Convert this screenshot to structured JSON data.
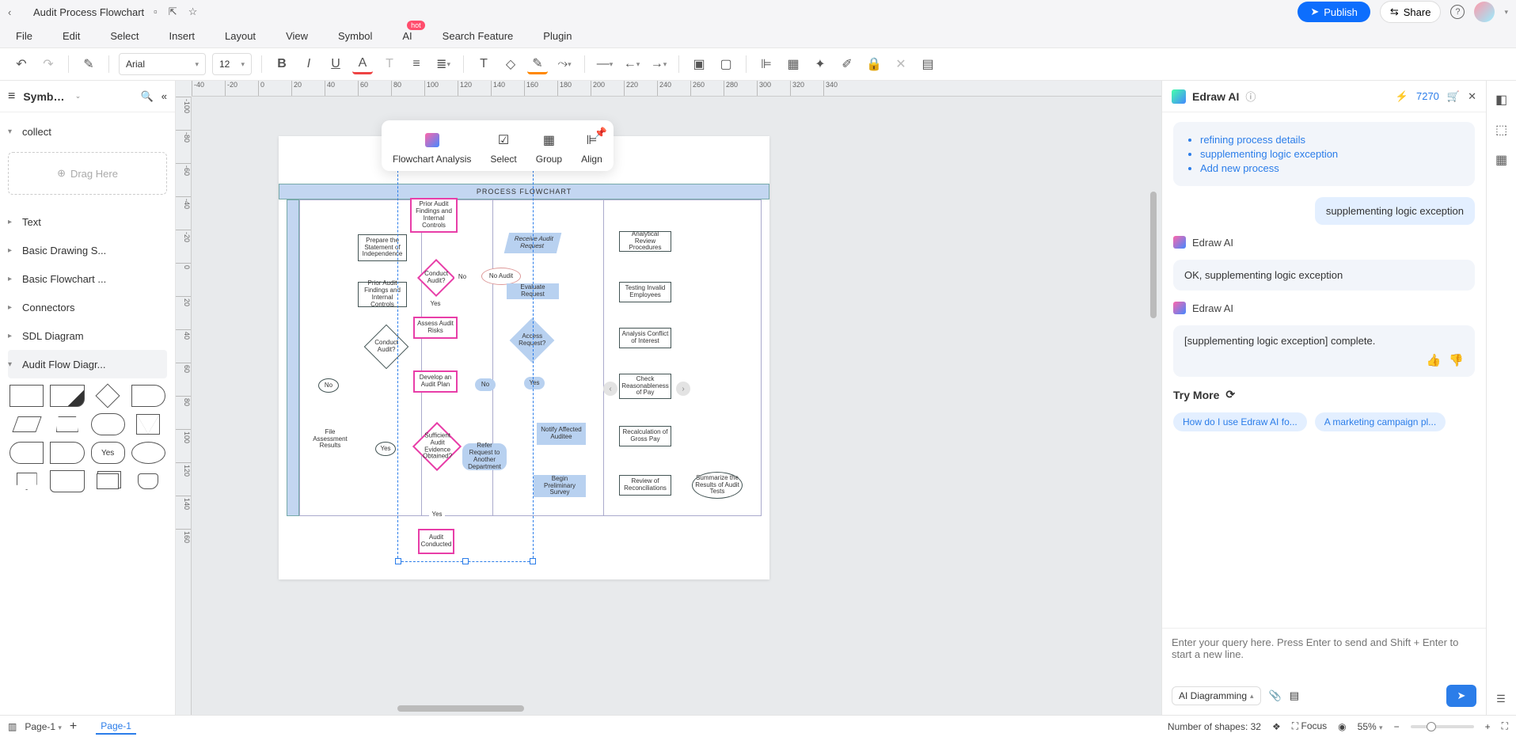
{
  "title": "Audit Process Flowchart",
  "menubar": [
    "File",
    "Edit",
    "Select",
    "Insert",
    "Layout",
    "View",
    "Symbol",
    "AI",
    "Search Feature",
    "Plugin"
  ],
  "hot_badge": "hot",
  "publish": "Publish",
  "share": "Share",
  "toolbar": {
    "font": "Arial",
    "size": "12"
  },
  "sidebar": {
    "title": "Symbo...",
    "collect": "collect",
    "drag_here": "Drag Here",
    "sections": [
      "Text",
      "Basic Drawing S...",
      "Basic Flowchart ...",
      "Connectors",
      "SDL Diagram",
      "Audit Flow Diagr..."
    ]
  },
  "rulerH": [
    "-40",
    "-20",
    "0",
    "20",
    "40",
    "60",
    "80",
    "100",
    "120",
    "140",
    "160",
    "180",
    "200",
    "220",
    "240",
    "260",
    "280",
    "300",
    "320",
    "340"
  ],
  "rulerV": [
    "-100",
    "-80",
    "-60",
    "-40",
    "-20",
    "0",
    "20",
    "40",
    "60",
    "80",
    "100",
    "120",
    "140",
    "160"
  ],
  "popup": {
    "analysis": "Flowchart Analysis",
    "select": "Select",
    "group": "Group",
    "align": "Align"
  },
  "flow": {
    "band_title": "PROCESS FLOWCHART",
    "col_a": {
      "prepare_statement": "Prepare the Statement of Independence",
      "prior_findings": "Prior Audit Findings and Internal Controls",
      "conduct_audit": "Conduct Audit?",
      "no_label": "No",
      "file_results": "File Assessment Results",
      "yes_label": "Yes"
    },
    "col_b": {
      "prepare": "Prepare the",
      "prior": "Prior Audit Findings and Internal Controls",
      "conduct_audit_d": "Conduct Audit?",
      "no": "No",
      "yes": "Yes",
      "assess": "Assess Audit Risks",
      "develop": "Develop an Audit Plan",
      "sufficient": "Sufficient Audit Evidence Obtained?",
      "yes2": "Yes",
      "conducted": "Audit Conducted"
    },
    "col_c": {
      "receive": "Receive Audit Request",
      "no_audit": "No Audit",
      "evaluate": "Evaluate Request",
      "access": "Access Request?",
      "yes": "Yes",
      "no": "No",
      "refer": "Refer Request to Another Department",
      "notify": "Notify Affected Auditee",
      "begin": "Begin Preliminary Survey"
    },
    "col_d": {
      "analytical": "Analytical Review Procedures",
      "testing": "Testing Invalid Employees",
      "analysis": "Analysis Conflict of Interest",
      "check": "Check Reasonableness of Pay",
      "recalc": "Recalculation of Gross Pay",
      "review": "Review of Reconciliations",
      "summarize": "Summarize the Results of Audit Tests"
    }
  },
  "ai": {
    "title": "Edraw AI",
    "credits": "7270",
    "suggestions": [
      "refining process details",
      "supplementing logic exception",
      "Add new process"
    ],
    "user_msg": "supplementing logic exception",
    "bot_label": "Edraw AI",
    "bot_msg1": "OK, supplementing logic exception",
    "bot_msg2": "[supplementing logic exception] complete.",
    "try_more": "Try More",
    "chips": [
      "How do I use Edraw AI fo...",
      "A marketing campaign pl..."
    ],
    "placeholder": "Enter your query here. Press Enter to send and Shift + Enter to start a new line.",
    "mode": "AI Diagramming"
  },
  "status": {
    "page_select": "Page-1",
    "page_tab": "Page-1",
    "shapes": "Number of shapes: 32",
    "focus": "Focus",
    "zoom": "55%"
  }
}
